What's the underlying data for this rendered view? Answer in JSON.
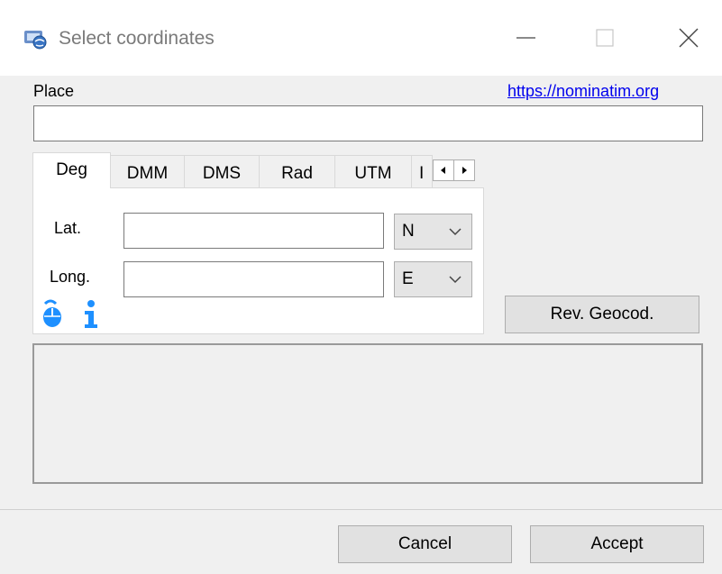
{
  "window": {
    "title": "Select coordinates",
    "icon": "app-globe-icon"
  },
  "controls": {
    "minimize": "minimize-icon",
    "maximize": "maximize-icon",
    "close": "close-icon"
  },
  "place": {
    "label": "Place",
    "link_text": "https://nominatim.org",
    "value": ""
  },
  "tabs": {
    "items": [
      "Deg",
      "DMM",
      "DMS",
      "Rad",
      "UTM",
      "I"
    ],
    "active": "Deg"
  },
  "deg": {
    "lat_label": "Lat.",
    "lat_value": "",
    "lat_hemisphere": "N",
    "long_label": "Long.",
    "long_value": "",
    "long_hemisphere": "E",
    "icons": [
      "mouse-pick-icon",
      "info-icon"
    ]
  },
  "buttons": {
    "rev_geocod": "Rev. Geocod.",
    "cancel": "Cancel",
    "accept": "Accept"
  },
  "colors": {
    "link": "#0000ee",
    "icon_blue": "#1e90ff"
  }
}
